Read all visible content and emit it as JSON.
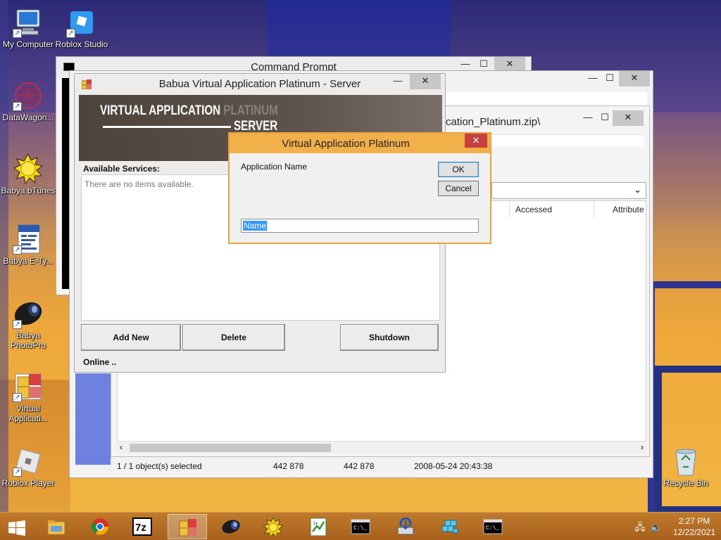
{
  "desktop": {
    "icons": [
      {
        "label": "My Computer",
        "icon": "computer-icon"
      },
      {
        "label": "Roblox Studio",
        "icon": "roblox-studio-icon"
      },
      {
        "label": "DataWagon...",
        "icon": "datawagon-icon"
      },
      {
        "label": "Babya bTunes",
        "icon": "sun-icon"
      },
      {
        "label": "Babya E-Ty...",
        "icon": "document-icon"
      },
      {
        "label": "Babya PhotoPro",
        "icon": "camera-lens-icon"
      },
      {
        "label": "Virtual Applicati...",
        "icon": "virtual-app-icon"
      },
      {
        "label": "Roblox Player",
        "icon": "roblox-player-icon"
      },
      {
        "label": "Recycle Bin",
        "icon": "recycle-bin-icon"
      }
    ]
  },
  "cmd_window": {
    "title": "Command Prompt"
  },
  "explorer": {
    "path_fragment": "cation_Platinum.zip\\",
    "columns": [
      "Accessed",
      "Attribute"
    ],
    "status": {
      "selection": "1 / 1 object(s) selected",
      "size": "442 878",
      "packed": "442 878",
      "modified": "2008-05-24 20:43:38"
    }
  },
  "server": {
    "title": "Babua Virtual Application Platinum - Server",
    "banner_line1": "VIRTUAL APPLICATION ",
    "banner_line1_fade": "PLATINUM",
    "banner_line2": "SERVER",
    "services_label": "Available Services:",
    "empty_text": "There are no items available.",
    "add_new": "Add New",
    "delete": "Delete",
    "shutdown": "Shutdown",
    "status": "Online .."
  },
  "dialog": {
    "title": "Virtual Application Platinum",
    "label": "Application Name",
    "ok": "OK",
    "cancel": "Cancel",
    "input_value": "Name"
  },
  "window_buttons": {
    "minimize": "—",
    "maximize": "☐",
    "close": "✕"
  },
  "taskbar": {
    "items": [
      "start-icon",
      "file-explorer-icon",
      "chrome-icon",
      "7zip-icon",
      "virtual-app-icon",
      "camera-lens-icon",
      "sun-icon",
      "notepad-plus-icon",
      "cmd-icon",
      "installer-icon",
      "cubes-icon",
      "cmd-icon"
    ],
    "time": "2:27 PM",
    "date": "12/22/2021"
  },
  "colors": {
    "dialog_accent": "#f1b04a",
    "close_red": "#c74040",
    "taskbar": "#b46c22",
    "selection": "#3399ff"
  }
}
